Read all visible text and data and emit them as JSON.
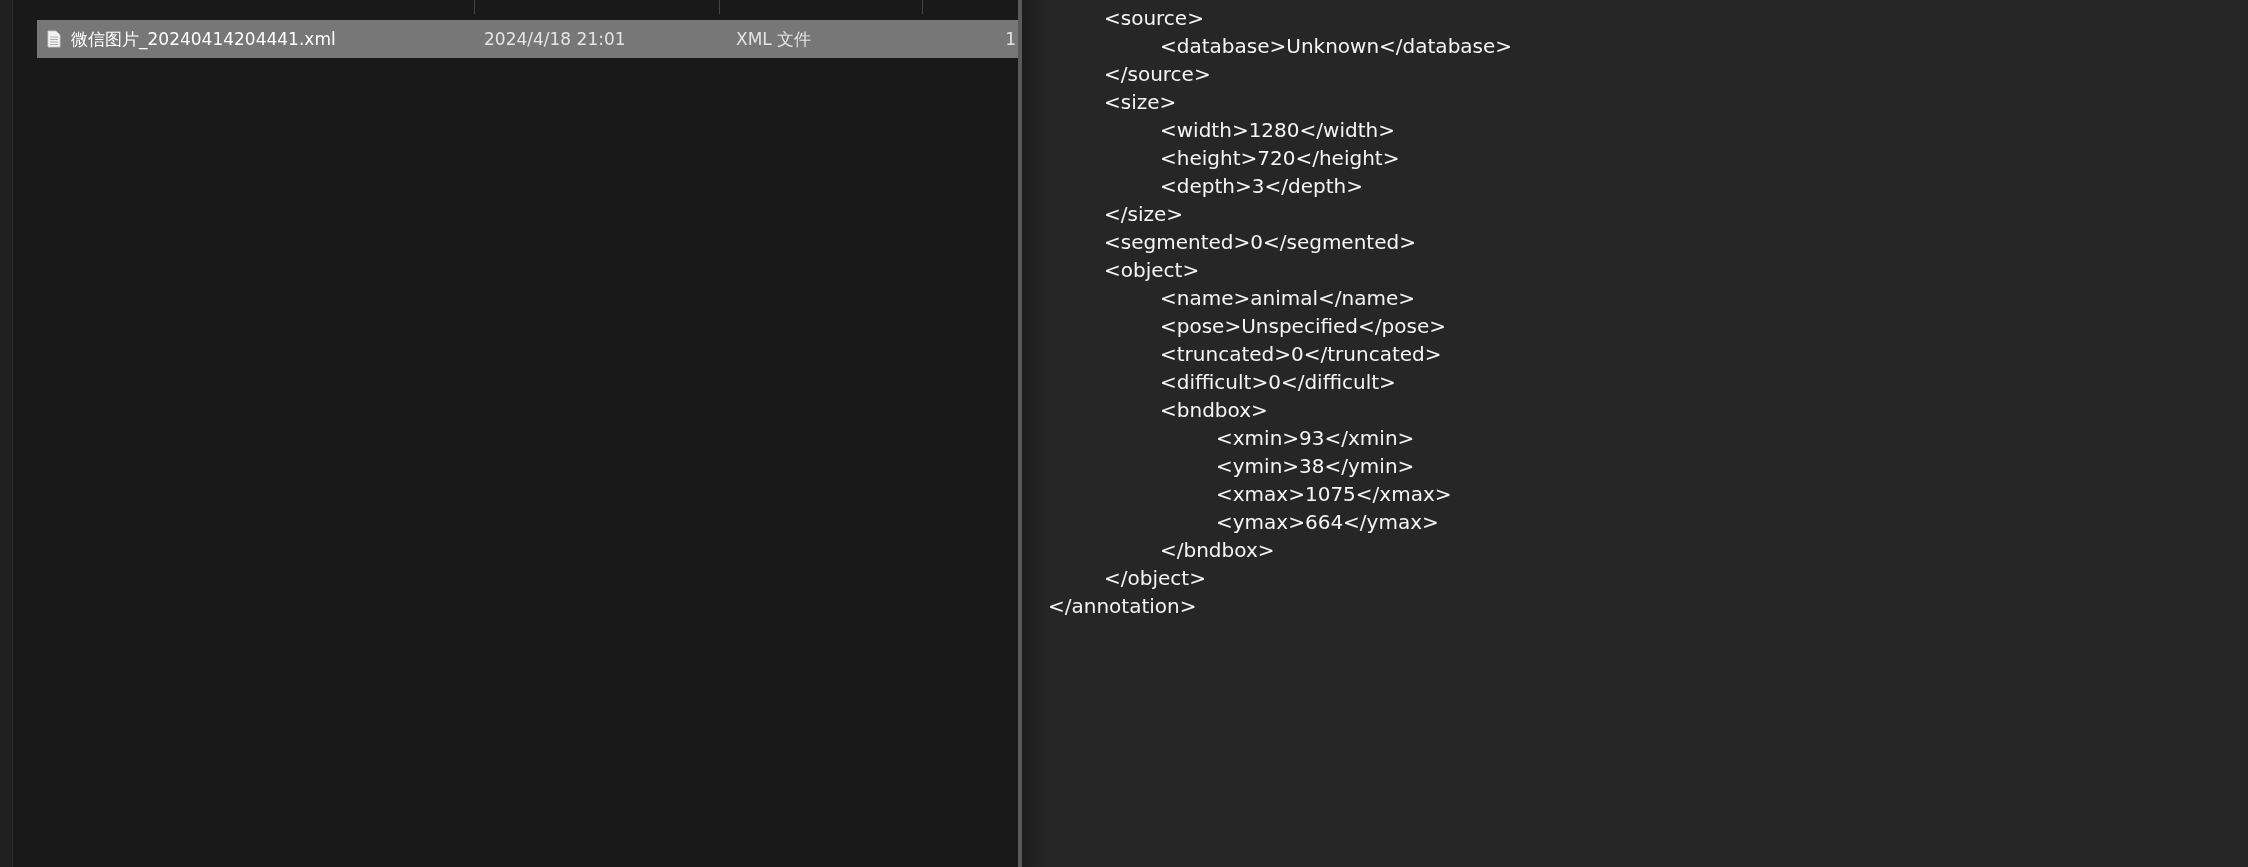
{
  "file_list": {
    "rows": [
      {
        "name": "微信图片_20240414204441.xml",
        "date": "2024/4/18 21:01",
        "type": "XML 文件",
        "size": "1",
        "selected": true
      }
    ]
  },
  "editor": {
    "lines": [
      {
        "children": [
          {
            "text": "<source>",
            "children": [
              {
                "text": "<database>Unknown</database>"
              }
            ]
          },
          {
            "text": "</source>"
          },
          {
            "text": "<size>",
            "children": [
              {
                "text": "<width>1280</width>"
              },
              {
                "text": "<height>720</height>"
              },
              {
                "text": "<depth>3</depth>"
              }
            ]
          },
          {
            "text": "</size>"
          },
          {
            "text": "<segmented>0</segmented>"
          },
          {
            "text": "<object>",
            "children": [
              {
                "text": "<name>animal</name>"
              },
              {
                "text": "<pose>Unspecified</pose>"
              },
              {
                "text": "<truncated>0</truncated>"
              },
              {
                "text": "<difficult>0</difficult>"
              },
              {
                "text": "<bndbox>",
                "children": [
                  {
                    "text": "<xmin>93</xmin>"
                  },
                  {
                    "text": "<ymin>38</ymin>"
                  },
                  {
                    "text": "<xmax>1075</xmax>"
                  },
                  {
                    "text": "<ymax>664</ymax>"
                  }
                ]
              },
              {
                "text": "</bndbox>"
              }
            ]
          },
          {
            "text": "</object>"
          }
        ]
      },
      {
        "text": "</annotation>"
      }
    ]
  }
}
